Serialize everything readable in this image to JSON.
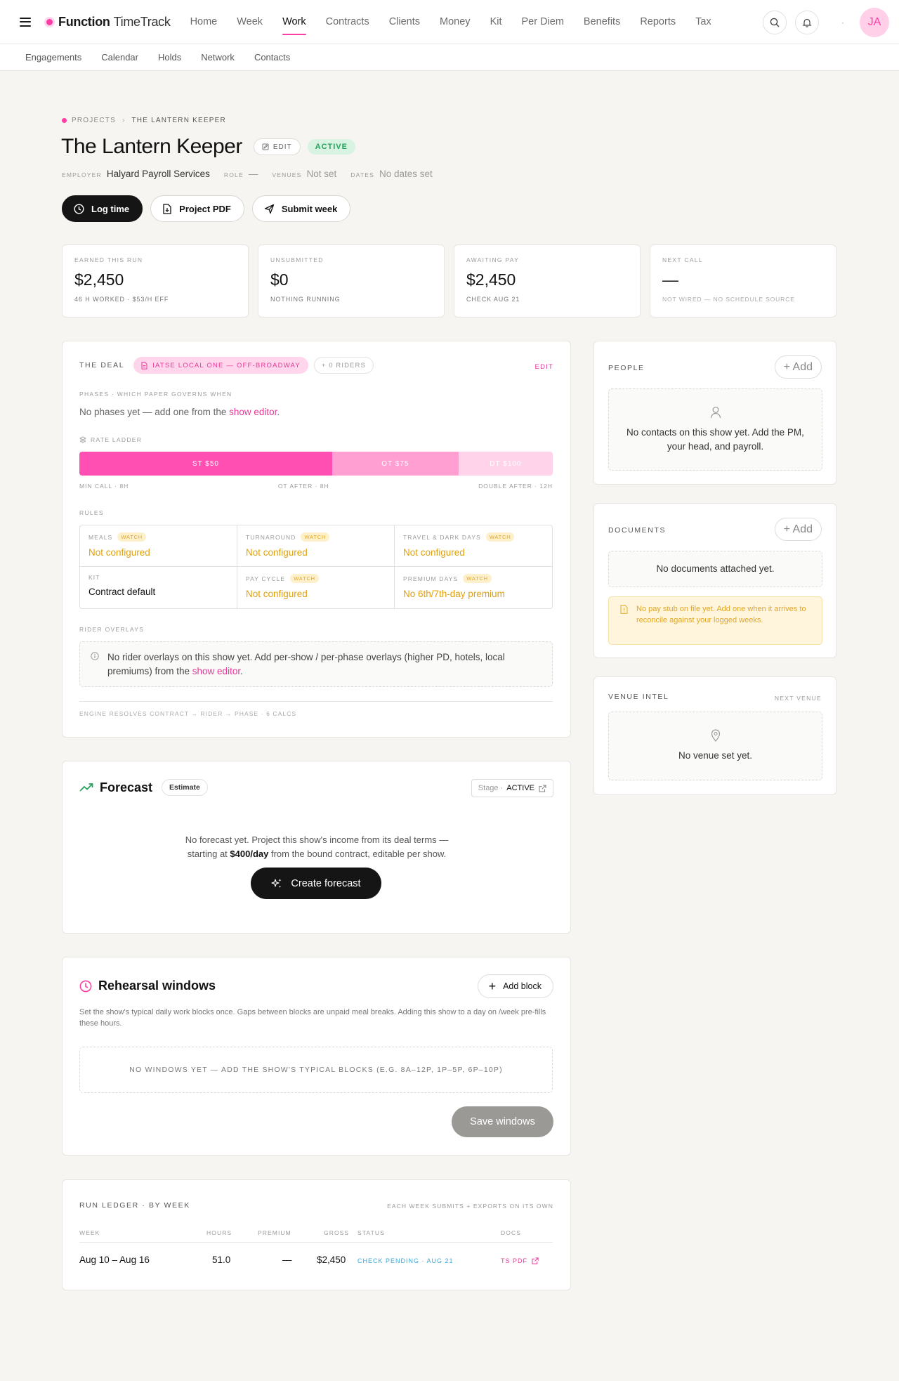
{
  "app": {
    "brand_bold": "Function",
    "brand_light": "TimeTrack",
    "avatar_initials": "JA",
    "dot": "·",
    "accent": "#ff3ea5"
  },
  "nav": [
    {
      "label": "Home",
      "active": false
    },
    {
      "label": "Week",
      "active": false
    },
    {
      "label": "Work",
      "active": true
    },
    {
      "label": "Contracts",
      "active": false
    },
    {
      "label": "Clients",
      "active": false
    },
    {
      "label": "Money",
      "active": false
    },
    {
      "label": "Kit",
      "active": false
    },
    {
      "label": "Per Diem",
      "active": false
    },
    {
      "label": "Benefits",
      "active": false
    },
    {
      "label": "Reports",
      "active": false
    },
    {
      "label": "Tax",
      "active": false
    }
  ],
  "subnav": [
    "Engagements",
    "Calendar",
    "Holds",
    "Network",
    "Contacts"
  ],
  "breadcrumb": {
    "root": "PROJECTS",
    "sep": "›",
    "current": "THE LANTERN KEEPER"
  },
  "project": {
    "title": "The Lantern Keeper",
    "edit_label": "EDIT",
    "status": "ACTIVE",
    "meta": {
      "employer_k": "EMPLOYER",
      "employer_v": "Halyard Payroll Services",
      "role_k": "ROLE",
      "role_v": "—",
      "venues_k": "VENUES",
      "venues_v": "Not set",
      "dates_k": "DATES",
      "dates_v": "No dates set"
    }
  },
  "actions": {
    "log_time": "Log time",
    "project_pdf": "Project PDF",
    "submit_week": "Submit week"
  },
  "stats": [
    {
      "label": "EARNED THIS RUN",
      "value": "$2,450",
      "sub": "46 H WORKED · $53/H EFF"
    },
    {
      "label": "UNSUBMITTED",
      "value": "$0",
      "sub": "NOTHING RUNNING"
    },
    {
      "label": "AWAITING PAY",
      "value": "$2,450",
      "sub": "CHECK AUG 21"
    },
    {
      "label": "NEXT CALL",
      "value": "—",
      "sub": "NOT WIRED — NO SCHEDULE SOURCE"
    }
  ],
  "deal": {
    "title": "THE DEAL",
    "contract": "IATSE LOCAL ONE — OFF-BROADWAY",
    "riders": "+ 0 RIDERS",
    "edit": "EDIT",
    "phases_caption": "PHASES · WHICH PAPER GOVERNS WHEN",
    "phases_text": "No phases yet — add one from the ",
    "phases_link": "show editor",
    "phases_end": ".",
    "rate_caption": "RATE LADDER",
    "ladder": [
      {
        "label": "ST $50",
        "share": 0.534,
        "color": "#ff4fb2"
      },
      {
        "label": "OT $75",
        "share": 0.267,
        "color": "#ff9fd2"
      },
      {
        "label": "DT $100",
        "share": 0.199,
        "color": "#ffd3ea"
      }
    ],
    "ladder_marks": [
      "MIN CALL · 8H",
      "OT AFTER · 8H",
      "DOUBLE AFTER · 12H"
    ],
    "rules_caption": "RULES",
    "rules": [
      {
        "k": "MEALS",
        "watch": "WATCH",
        "v": "Not configured",
        "warn": true
      },
      {
        "k": "TURNAROUND",
        "watch": "WATCH",
        "v": "Not configured",
        "warn": true
      },
      {
        "k": "TRAVEL & DARK DAYS",
        "watch": "WATCH",
        "v": "Not configured",
        "warn": true
      },
      {
        "k": "KIT",
        "watch": "",
        "v": "Contract default",
        "warn": false
      },
      {
        "k": "PAY CYCLE",
        "watch": "WATCH",
        "v": "Not configured",
        "warn": true
      },
      {
        "k": "PREMIUM DAYS",
        "watch": "WATCH",
        "v": "No 6th/7th-day premium",
        "warn": true
      }
    ],
    "rider_caption": "RIDER OVERLAYS",
    "rider_text": "No rider overlays on this show yet. Add per-show / per-phase overlays (higher PD, hotels, local premiums) from the ",
    "rider_link": "show editor",
    "rider_end": ".",
    "footer": "ENGINE RESOLVES CONTRACT → RIDER → PHASE · 6 CALCS"
  },
  "people": {
    "title": "PEOPLE",
    "add": "+ Add",
    "empty": "No contacts on this show yet. Add the PM, your head, and payroll."
  },
  "documents": {
    "title": "DOCUMENTS",
    "add": "+ Add",
    "empty": "No documents attached yet.",
    "warning": "No pay stub on file yet. Add one when it arrives to reconcile against your logged weeks."
  },
  "venue": {
    "title": "VENUE INTEL",
    "note": "NEXT VENUE",
    "empty": "No venue set yet."
  },
  "forecast": {
    "title": "Forecast",
    "badge": "Estimate",
    "stage_k": "Stage ·",
    "stage_v": "ACTIVE",
    "text_a": "No forecast yet. Project this show's income from its deal terms —",
    "text_b": "starting at ",
    "rate": "$400/day",
    "text_c": " from the bound contract, editable per show.",
    "button": "Create forecast"
  },
  "rehearsal": {
    "title": "Rehearsal windows",
    "add": "Add block",
    "desc": "Set the show's typical daily work blocks once. Gaps between blocks are unpaid meal breaks. Adding this show to a day on /week pre-fills these hours.",
    "empty": "NO WINDOWS YET — ADD THE SHOW'S TYPICAL BLOCKS (E.G. 8A–12P, 1P–5P, 6P–10P)",
    "save": "Save windows"
  },
  "ledger": {
    "title": "RUN LEDGER · BY WEEK",
    "note": "EACH WEEK SUBMITS + EXPORTS ON ITS OWN",
    "columns": [
      "WEEK",
      "HOURS",
      "PREMIUM",
      "GROSS",
      "STATUS",
      "DOCS"
    ],
    "rows": [
      {
        "week": "Aug 10 – Aug 16",
        "hours": "51.0",
        "premium": "—",
        "gross": "$2,450",
        "status": "CHECK PENDING · AUG 21",
        "docs": "TS PDF"
      }
    ]
  }
}
